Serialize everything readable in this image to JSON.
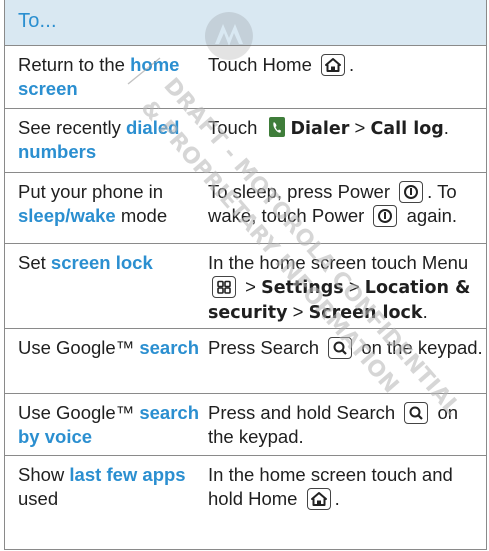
{
  "header": {
    "label": "To..."
  },
  "rows": [
    {
      "left": [
        {
          "t": "Return to the "
        },
        {
          "t": "home screen",
          "s": "hl"
        }
      ],
      "right": [
        {
          "t": "Touch Home "
        },
        {
          "icon": "home-key-icon"
        },
        {
          "t": "."
        }
      ]
    },
    {
      "left": [
        {
          "t": "See recently "
        },
        {
          "t": "dialed numbers",
          "s": "hl"
        }
      ],
      "right": [
        {
          "t": "Touch "
        },
        {
          "icon": "dialer-app-icon"
        },
        {
          "t": "Dialer",
          "s": "b"
        },
        {
          "t": " > "
        },
        {
          "t": "Call log",
          "s": "b"
        },
        {
          "t": "."
        }
      ]
    },
    {
      "left": [
        {
          "t": " Put your phone in "
        },
        {
          "t": "sleep/wake",
          "s": "hl"
        },
        {
          "t": " mode"
        }
      ],
      "right": [
        {
          "t": "To sleep, press Power "
        },
        {
          "icon": "power-key-icon"
        },
        {
          "t": ". To wake, touch Power "
        },
        {
          "icon": "power-key-icon"
        },
        {
          "t": " again."
        }
      ]
    },
    {
      "left": [
        {
          "t": "Set "
        },
        {
          "t": "screen lock",
          "s": "hl"
        }
      ],
      "right": [
        {
          "t": "In the home screen touch Menu "
        },
        {
          "icon": "menu-key-icon"
        },
        {
          "t": " > "
        },
        {
          "t": "Settings",
          "s": "b"
        },
        {
          "t": " > "
        },
        {
          "t": "Location & security",
          "s": "b"
        },
        {
          "t": " > "
        },
        {
          "t": "Screen lock",
          "s": "b"
        },
        {
          "t": "."
        }
      ]
    },
    {
      "left": [
        {
          "t": "Use Google™ "
        },
        {
          "t": "search",
          "s": "hl"
        }
      ],
      "right": [
        {
          "t": "Press Search "
        },
        {
          "icon": "search-key-icon"
        },
        {
          "t": " on the keypad."
        }
      ]
    },
    {
      "left": [
        {
          "t": "Use Google™ "
        },
        {
          "t": "search by voice",
          "s": "hl"
        }
      ],
      "right": [
        {
          "t": "Press and hold Search "
        },
        {
          "icon": "search-key-icon"
        },
        {
          "t": " on the keypad."
        }
      ]
    },
    {
      "left": [
        {
          "t": "Show "
        },
        {
          "t": "last few apps",
          "s": "hl"
        },
        {
          "t": " used"
        }
      ],
      "right": [
        {
          "t": "In the home screen touch and hold Home "
        },
        {
          "icon": "home-key-icon"
        },
        {
          "t": "."
        }
      ]
    }
  ],
  "watermark": {
    "line1": "DRAFT - MOTOROLA CONFIDENTIAL",
    "line2": "& PROPRIETARY INFORMATION"
  }
}
